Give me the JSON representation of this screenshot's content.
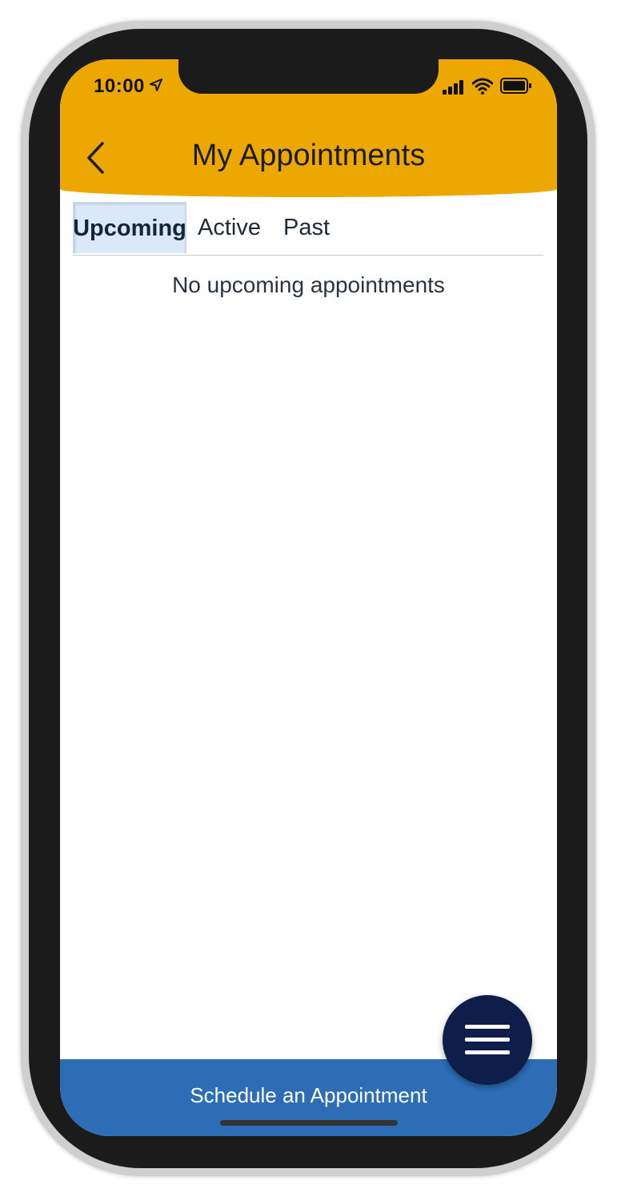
{
  "status_bar": {
    "time": "10:00",
    "icons": [
      "location-arrow-icon",
      "signal-bars-icon",
      "wifi-icon",
      "battery-icon"
    ]
  },
  "header": {
    "title": "My Appointments",
    "back_icon": "chevron-left-icon",
    "background_color": "#eca800"
  },
  "tabs": [
    {
      "label": "Upcoming",
      "active": true
    },
    {
      "label": "Active",
      "active": false
    },
    {
      "label": "Past",
      "active": false
    }
  ],
  "content": {
    "empty_message": "No upcoming appointments"
  },
  "bottom_bar": {
    "label": "Schedule an Appointment",
    "background_color": "#2c6db5"
  },
  "fab": {
    "icon": "hamburger-menu-icon",
    "background_color": "#0e1d4a"
  }
}
